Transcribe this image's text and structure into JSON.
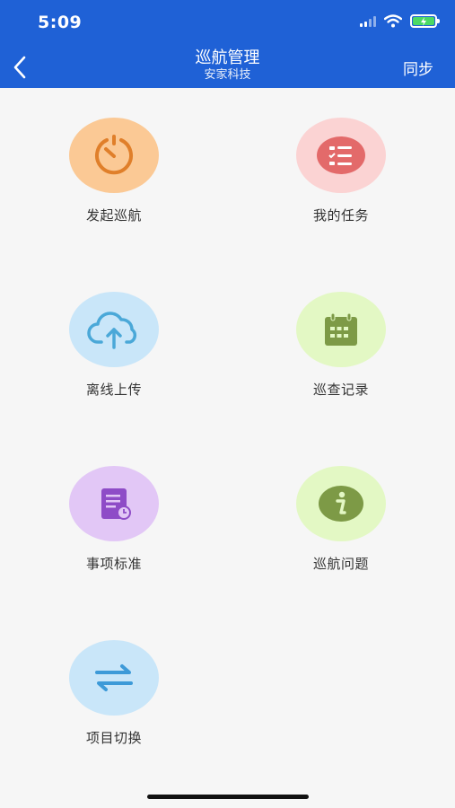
{
  "status_bar": {
    "time": "5:09",
    "battery_color": "#4cd964"
  },
  "header": {
    "title": "巡航管理",
    "subtitle": "安家科技",
    "back_icon": "chevron-left-icon",
    "sync_label": "同步",
    "background": "#1f61d6"
  },
  "menu": {
    "items": [
      {
        "label": "发起巡航",
        "icon": "timer-icon",
        "bg": "#fbc995",
        "fg": "#e07f2a"
      },
      {
        "label": "我的任务",
        "icon": "task-list-icon",
        "bg": "#fbd3d3",
        "fg": "#e36a6a"
      },
      {
        "label": "离线上传",
        "icon": "cloud-upload-icon",
        "bg": "#c9e6f9",
        "fg": "#4aa8d8"
      },
      {
        "label": "巡查记录",
        "icon": "calendar-icon",
        "bg": "#e3f8c4",
        "fg": "#7d9a46"
      },
      {
        "label": "事项标准",
        "icon": "document-clock-icon",
        "bg": "#e2c7f6",
        "fg": "#8e4cc7"
      },
      {
        "label": "巡航问题",
        "icon": "info-icon",
        "bg": "#e3f8c4",
        "fg": "#7d9a46"
      },
      {
        "label": "项目切换",
        "icon": "swap-arrows-icon",
        "bg": "#c9e6f9",
        "fg": "#3d9ad8"
      }
    ]
  }
}
